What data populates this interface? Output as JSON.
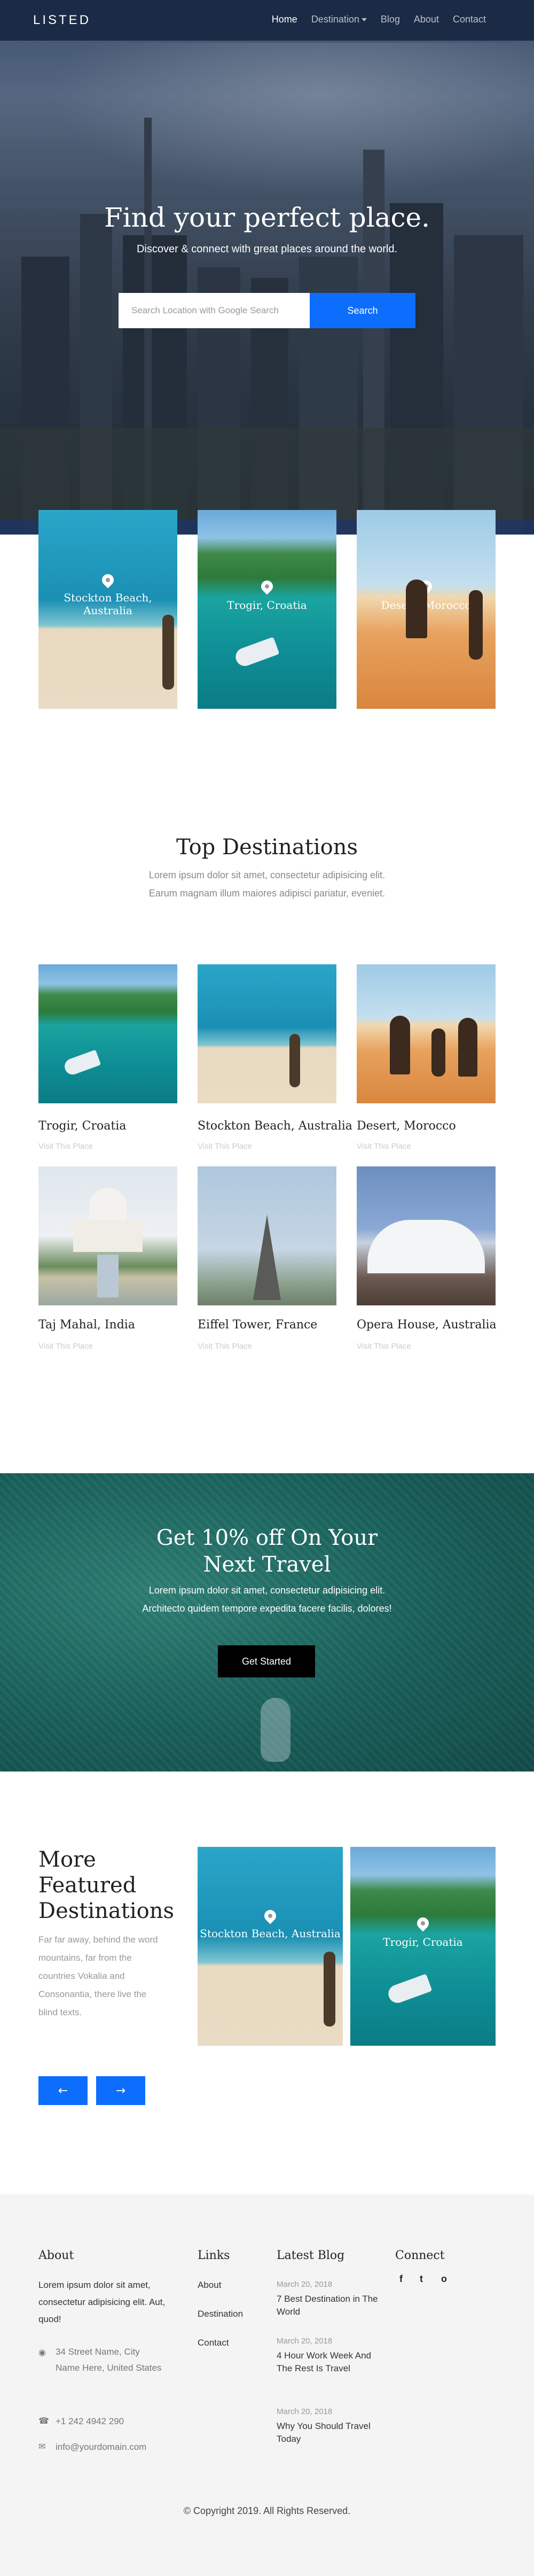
{
  "nav": {
    "brand": "LISTED",
    "items": [
      "Home",
      "Destination",
      "Blog",
      "About",
      "Contact"
    ]
  },
  "hero": {
    "title": "Find your perfect place.",
    "subtitle": "Discover & connect with great places around the world.",
    "search_placeholder": "Search Location with Google Search",
    "search_button": "Search"
  },
  "hero_cards": [
    {
      "label": "Stockton Beach, Australia"
    },
    {
      "label": "Trogir, Croatia"
    },
    {
      "label": "Desert, Morocco"
    }
  ],
  "top_destinations": {
    "title": "Top Destinations",
    "text": "Lorem ipsum dolor sit amet, consectetur adipisicing elit. Earum magnam illum maiores adipisci pariatur, eveniet.",
    "items": [
      {
        "name": "Trogir, Croatia",
        "link": "Visit This Place"
      },
      {
        "name": "Stockton Beach, Australia",
        "link": "Visit This Place"
      },
      {
        "name": "Desert, Morocco",
        "link": "Visit This Place"
      },
      {
        "name": "Taj Mahal, India",
        "link": "Visit This Place"
      },
      {
        "name": "Eiffel Tower, France",
        "link": "Visit This Place"
      },
      {
        "name": "Opera House, Australia",
        "link": "Visit This Place"
      }
    ]
  },
  "promo": {
    "title": "Get 10% off On Your Next Travel",
    "text": "Lorem ipsum dolor sit amet, consectetur adipisicing elit. Architecto quidem tempore expedita facere facilis, dolores!",
    "button": "Get Started"
  },
  "featured": {
    "title": "More Featured Destinations",
    "text": "Far far away, behind the word mountains, far from the countries Vokalia and Consonantia, there live the blind texts.",
    "cards": [
      {
        "label": "Stockton Beach, Australia"
      },
      {
        "label": "Trogir, Croatia"
      }
    ],
    "prev": "←",
    "next": "→"
  },
  "footer": {
    "about_title": "About",
    "about_text": "Lorem ipsum dolor sit amet, consectetur adipisicing elit. Aut, quod!",
    "address": "34 Street Name, City Name Here, United States",
    "phone": "+1 242 4942 290",
    "email": "info@yourdomain.com",
    "links_title": "Links",
    "links": [
      "About",
      "Destination",
      "Contact"
    ],
    "blog_title": "Latest Blog",
    "posts": [
      {
        "date": "March 20, 2018",
        "title": "7 Best Destination in The World"
      },
      {
        "date": "March 20, 2018",
        "title": "4 Hour Work Week And The Rest Is Travel"
      },
      {
        "date": "March 20, 2018",
        "title": "Why You Should Travel Today"
      }
    ],
    "connect_title": "Connect",
    "social": [
      "f",
      "t",
      "o"
    ],
    "copyright": "© Copyright 2019. All Rights Reserved."
  }
}
